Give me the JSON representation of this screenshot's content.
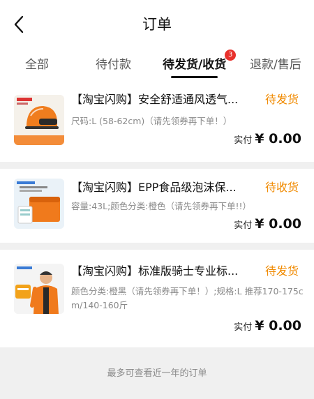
{
  "header": {
    "title": "订单"
  },
  "tabs": [
    {
      "label": "全部"
    },
    {
      "label": "待付款"
    },
    {
      "label": "待发货/收货",
      "badge": "3",
      "active": true
    },
    {
      "label": "退款/售后"
    }
  ],
  "orders": [
    {
      "title": "【淘宝闪购】安全舒适通风透气...",
      "status": "待发货",
      "spec": "尺码:L (58-62cm)（请先领券再下单！）",
      "pay_label": "实付",
      "pay_amount": "¥ 0.00",
      "thumb_icon": "helmet-thumbnail"
    },
    {
      "title": "【淘宝闪购】EPP食品级泡沫保...",
      "status": "待收货",
      "spec": "容量:43L;颜色分类:橙色（请先领券再下单!!）",
      "pay_label": "实付",
      "pay_amount": "¥ 0.00",
      "thumb_icon": "delivery-box-thumbnail"
    },
    {
      "title": "【淘宝闪购】标准版骑士专业标...",
      "status": "待发货",
      "spec": "颜色分类:橙黑（请先领券再下单！）;规格:L 推荐170-175cm/140-160斤",
      "pay_label": "实付",
      "pay_amount": "¥ 0.00",
      "thumb_icon": "rider-uniform-thumbnail"
    }
  ],
  "footer": {
    "note": "最多可查看近一年的订单"
  },
  "colors": {
    "status": "#f08a00",
    "badge": "#e8312c",
    "accent_orange": "#f27a1a"
  }
}
